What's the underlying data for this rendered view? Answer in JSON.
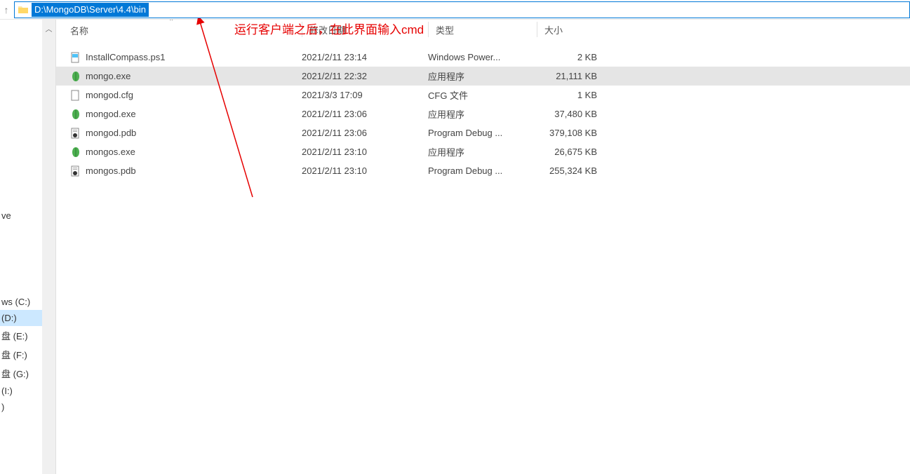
{
  "address_bar": {
    "path": "D:\\MongoDB\\Server\\4.4\\bin"
  },
  "annotation": "运行客户端之后，在此界面输入cmd",
  "nav_items_top": [
    {
      "label": ""
    },
    {
      "label": "ve"
    }
  ],
  "nav_items_bottom": [
    {
      "label": "ws (C:)",
      "selected": false
    },
    {
      "label": "(D:)",
      "selected": true
    },
    {
      "label": "盘 (E:)",
      "selected": false
    },
    {
      "label": "盘 (F:)",
      "selected": false
    },
    {
      "label": "盘 (G:)",
      "selected": false
    },
    {
      "label": "(I:)",
      "selected": false
    },
    {
      "label": ")",
      "selected": false
    }
  ],
  "columns": {
    "name": "名称",
    "date": "修改日期",
    "type": "类型",
    "size": "大小"
  },
  "files": [
    {
      "name": "InstallCompass.ps1",
      "date": "2021/2/11 23:14",
      "type": "Windows Power...",
      "size": "2 KB",
      "icon": "ps1",
      "selected": false
    },
    {
      "name": "mongo.exe",
      "date": "2021/2/11 22:32",
      "type": "应用程序",
      "size": "21,111 KB",
      "icon": "leaf",
      "selected": true
    },
    {
      "name": "mongod.cfg",
      "date": "2021/3/3 17:09",
      "type": "CFG 文件",
      "size": "1 KB",
      "icon": "cfg",
      "selected": false
    },
    {
      "name": "mongod.exe",
      "date": "2021/2/11 23:06",
      "type": "应用程序",
      "size": "37,480 KB",
      "icon": "leaf",
      "selected": false
    },
    {
      "name": "mongod.pdb",
      "date": "2021/2/11 23:06",
      "type": "Program Debug ...",
      "size": "379,108 KB",
      "icon": "pdb",
      "selected": false
    },
    {
      "name": "mongos.exe",
      "date": "2021/2/11 23:10",
      "type": "应用程序",
      "size": "26,675 KB",
      "icon": "leaf",
      "selected": false
    },
    {
      "name": "mongos.pdb",
      "date": "2021/2/11 23:10",
      "type": "Program Debug ...",
      "size": "255,324 KB",
      "icon": "pdb",
      "selected": false
    }
  ],
  "icons": {
    "folder_color": "#ffd868",
    "leaf_color": "#4caf50",
    "pdb_bg": "#fff",
    "ps1_bg": "#fff"
  }
}
